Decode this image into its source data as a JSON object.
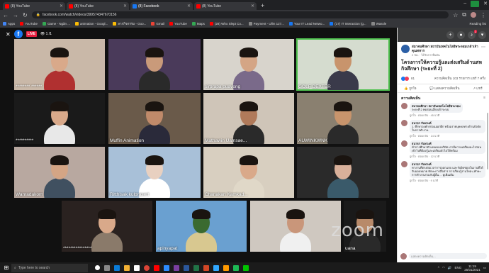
{
  "browser": {
    "tabs": [
      {
        "label": "(8) YouTube",
        "color": "#ff0000",
        "active": false
      },
      {
        "label": "(8) YouTube",
        "color": "#ff0000",
        "active": false
      },
      {
        "label": "(8) Facebook",
        "color": "#1877f2",
        "active": true
      },
      {
        "label": "(8) YouTube",
        "color": "#ff0000",
        "active": false
      }
    ],
    "new_tab": "+",
    "url": "facebook.com/watch/videos/399574347670156",
    "bookmarks": [
      {
        "label": "Apps",
        "color": "#4285f4"
      },
      {
        "label": "YouTube",
        "color": "#ff0000"
      },
      {
        "label": "Game - Ngăn ...",
        "color": "#34a853"
      },
      {
        "label": "animation - Googl...",
        "color": "#fbbc05"
      },
      {
        "label": "ลากกิจกรรม - Goo...",
        "color": "#fbbc05"
      },
      {
        "label": "Gmail",
        "color": "#ea4335"
      },
      {
        "label": "YouTube",
        "color": "#ff0000"
      },
      {
        "label": "Maps",
        "color": "#34a853"
      },
      {
        "label": "(28) Who Slept Co...",
        "color": "#ff0000"
      },
      {
        "label": "Payment - Ullm 127...",
        "color": "#888888"
      },
      {
        "label": "Your IT Lead Netwo...",
        "color": "#1877f2"
      },
      {
        "label": "(17) IT Interaction (g...",
        "color": "#1877f2"
      },
      {
        "label": "Wassle",
        "color": "#888888"
      }
    ],
    "reading_list": "Reading list"
  },
  "video": {
    "live_badge": "LIVE",
    "viewers": "1 /1",
    "zoom_watermark": "zoom",
    "tiles": [
      {
        "name": "******** ******",
        "bg": "#c9b8a8",
        "skin": "#d9a98a",
        "shirt": "#b03030"
      },
      {
        "name": "",
        "bg": "#4a3a5a",
        "skin": "#c99a7a",
        "shirt": "#2a2a2a"
      },
      {
        "name": "sirprapa puavong",
        "bg": "#d8d4cc",
        "skin": "#d4a585",
        "shirt": "#7a6a8a"
      },
      {
        "name": "GOLF DEXTER",
        "bg": "#d5dccf",
        "skin": "#c8946c",
        "shirt": "#3a3a4a"
      },
      {
        "name": "**********",
        "bg": "#1a1a1a",
        "skin": "#d9a98a",
        "shirt": "#e8e8e8"
      },
      {
        "name": "Muffin Animation",
        "bg": "#6a5a4a",
        "skin": "#c08a6a",
        "shirt": "#2a2a3a"
      },
      {
        "name": "Mathawin Uamsae...",
        "bg": "#cfc5b8",
        "skin": "#b07a5a",
        "shirt": "#2a2a2a"
      },
      {
        "name": "AUWINKWNK",
        "bg": "#8a8070",
        "skin": "#c8946c",
        "shirt": "#2a2a2a"
      },
      {
        "name": "Wanradakorn",
        "bg": "#b8a8a0",
        "skin": "#d4a585",
        "shirt": "#405060"
      },
      {
        "name": "Ritthisak kulprasert",
        "bg": "#a8c0d8",
        "skin": "#e8d0c0",
        "shirt": "#ffffff"
      },
      {
        "name": "Chanakan Kamkad...",
        "bg": "#d8cfc0",
        "skin": "#d9a98a",
        "shirt": "#e0d8c8"
      },
      {
        "name": "",
        "bg": "#2a2a2a",
        "skin": "#d9b09a",
        "shirt": "#3a5a6a"
      },
      {
        "name": "****************",
        "bg": "#2a2220",
        "skin": "#d9a98a",
        "shirt": "#8a7a6a"
      },
      {
        "name": "apinyapat",
        "bg": "#6aa0d0",
        "skin": "#3a6a30",
        "shirt": "#d8c890"
      },
      {
        "name": "",
        "bg": "#cfc8c0",
        "skin": "#c9967a",
        "shirt": "#f0f0f0"
      },
      {
        "name": "uana",
        "bg": "#1a1a1a",
        "skin": "#b88a6a",
        "shirt": "#2a2a2a"
      }
    ]
  },
  "panel": {
    "notif_count": "2",
    "page_name": "สมาคมศึกษา สถาบันเทคโนโลยีพระจอมเกล้าเจ้าคุณทหาร",
    "page_sub": "2 ชม. · ได้รับการยืนยัน",
    "post_title": "โครงการให้ความรู้และส่งเสริมด้านสหกิจศึกษา (ระยะที่ 2)",
    "reaction_count": "81",
    "comment_share": "ความคิดเห็น 103 รายการ แชร์ 7 ครั้ง",
    "action_like": "ถูกใจ",
    "action_comment": "แสดงความคิดเห็น",
    "action_share": "แชร์",
    "comments_header": "ความคิดเห็น",
    "sort_icon": "≡",
    "comments": [
      {
        "name": "สมาคมศึกษา สถาบันเทคโนโลยีพระจอม",
        "text": "ระยะที่ 2 ทดสอบเสียงเข้าระบบ",
        "meta": "ถูกใจ · ตอบกลับ · 45 นาที"
      },
      {
        "name": "ธนาธร จันทวงค์",
        "text": "1. ศึกษาองค์กรก่อนออกฝึก พร้อมรายบุคคลทางด้านปัจจัยในการทำงาน",
        "meta": "ถูกใจ · ตอบกลับ · 14 นาที"
      },
      {
        "name": "ธนาธร จันทวงค์",
        "text": "ทำการศึกษาตัวแทนของบริษัท เรามีความเตรียมอะไรก่อนเข้าไปที่ต้องรู้และเตรียมตัวไปให้พร้อม",
        "meta": "ถูกใจ · ตอบกลับ · 12 นาที"
      },
      {
        "name": "ธนาธร จันทวงค์",
        "text": "ทางานที่ตรงต่อเวลาการออกแบบ และรับผิดชอบในงานที่ได้รับมอบหมาย ทักษะการสื่อสาร การเรียนรู้งานใหม่ๆ ทักษะการทำงานร่วมกับผู้อื่น ... ดูเพิ่มเติม",
        "meta": "ถูกใจ · ตอบกลับ · 9 นาที"
      }
    ],
    "composer_placeholder": "แสดงความคิดเห็น..."
  },
  "taskbar": {
    "search_placeholder": "Type here to search",
    "time": "11:19",
    "date": "25/01/2021",
    "lang": "ENG"
  }
}
